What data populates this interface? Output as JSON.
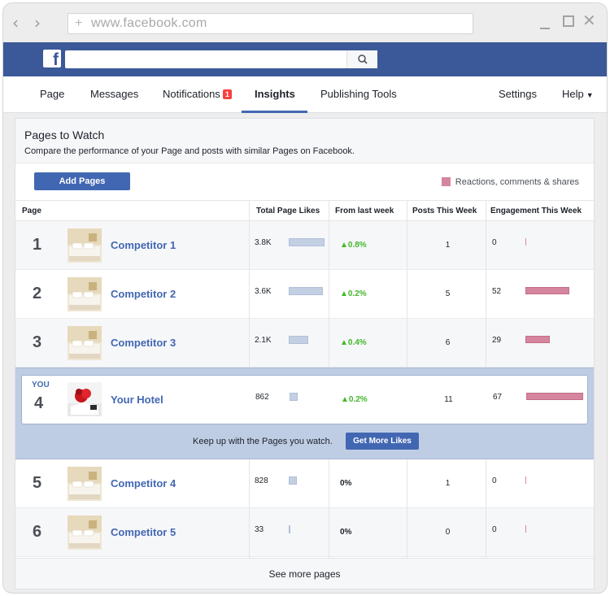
{
  "browser": {
    "url": "www.facebook.com",
    "back_icon": "chevron-left-icon",
    "forward_icon": "chevron-right-icon"
  },
  "fb": {
    "logo_letter": "f",
    "search_icon": "search-icon"
  },
  "tabs": [
    {
      "label": "Page"
    },
    {
      "label": "Messages"
    },
    {
      "label": "Notifications",
      "badge": "1"
    },
    {
      "label": "Insights",
      "active": true
    },
    {
      "label": "Publishing Tools"
    },
    {
      "label": "Settings"
    },
    {
      "label": "Help"
    }
  ],
  "panel": {
    "title": "Pages to Watch",
    "subtitle": "Compare the performance of your Page and posts with similar Pages on Facebook.",
    "add_button": "Add Pages",
    "legend_label": "Reactions, comments & shares",
    "legend_color": "#d5869e"
  },
  "columns": {
    "page": "Page",
    "likes": "Total Page Likes",
    "change": "From last week",
    "posts": "Posts This Week",
    "engagement": "Engagement This Week"
  },
  "rows": [
    {
      "rank": "1",
      "name": "Competitor 1",
      "likes": "3.8K",
      "likes_value": 3800,
      "change": "0.8%",
      "up": true,
      "posts": "1",
      "engagement": "0",
      "engagement_value": 0
    },
    {
      "rank": "2",
      "name": "Competitor 2",
      "likes": "3.6K",
      "likes_value": 3600,
      "change": "0.2%",
      "up": true,
      "posts": "5",
      "engagement": "52",
      "engagement_value": 52
    },
    {
      "rank": "3",
      "name": "Competitor 3",
      "likes": "2.1K",
      "likes_value": 2100,
      "change": "0.4%",
      "up": true,
      "posts": "6",
      "engagement": "29",
      "engagement_value": 29
    },
    {
      "rank": "5",
      "name": "Competitor 4",
      "likes": "828",
      "likes_value": 828,
      "change": "0%",
      "up": false,
      "posts": "1",
      "engagement": "0",
      "engagement_value": 0
    },
    {
      "rank": "6",
      "name": "Competitor 5",
      "likes": "33",
      "likes_value": 33,
      "change": "0%",
      "up": false,
      "posts": "0",
      "engagement": "0",
      "engagement_value": 0
    }
  ],
  "you": {
    "label": "YOU",
    "rank": "4",
    "name": "Your Hotel",
    "likes": "862",
    "likes_value": 862,
    "change": "0.2%",
    "up": true,
    "posts": "11",
    "engagement": "67",
    "engagement_value": 67
  },
  "promo": {
    "text": "Keep up with the Pages you watch.",
    "button": "Get More Likes"
  },
  "see_more": "See more pages"
}
